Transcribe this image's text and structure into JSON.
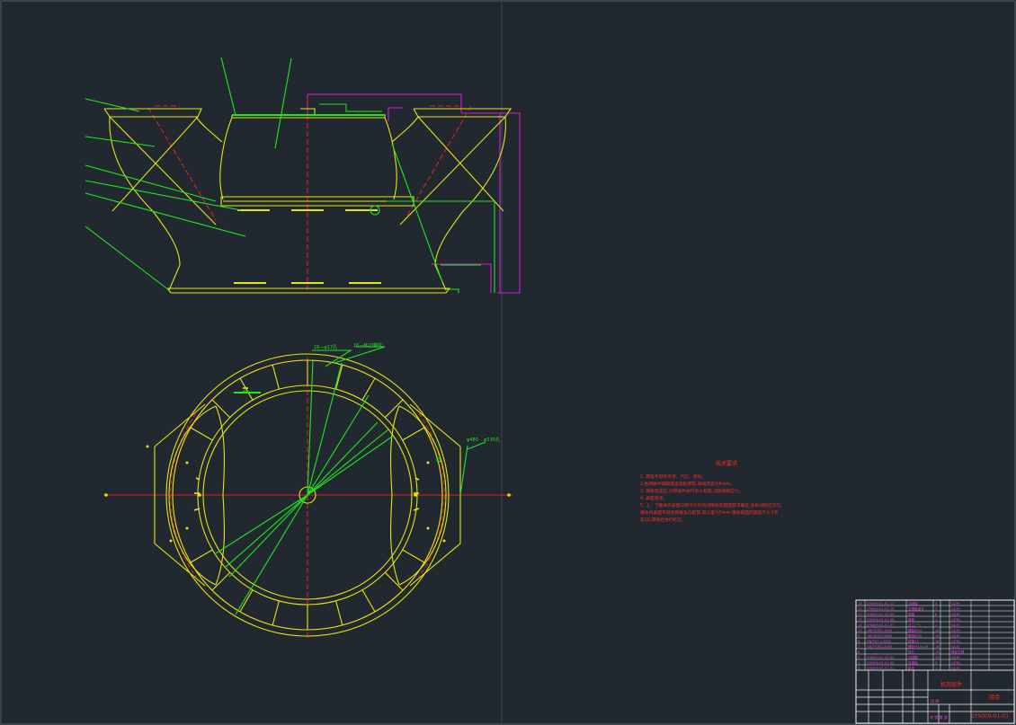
{
  "colors": {
    "background": "#212830",
    "outline": "#e4e414",
    "leader": "#1ee61e",
    "hidden": "#e11e1e",
    "boundary": "#d21ed2",
    "text_note": "#ff2a2a",
    "table_text": "#ff3ce6",
    "table_line": "#f2f2f2"
  },
  "labels": {
    "dim_top_1": "16—φ17孔",
    "dim_top_2": "16—M10螺纹",
    "dim_left": "80—",
    "dim_right_1": "φ480",
    "dim_right_2": "φ530孔"
  },
  "notes": {
    "title": "技术要求",
    "items": [
      "1. 焊缝不得有夹渣、气孔、裂纹。",
      "2.各焊接件焊脚高度按板厚取,焊缝高度为6mm。",
      "3. 焊接完成后,对焊接件进行退火处理,消除焊接应力。",
      "4. 表面涂漆。",
      "5. 上、下锥体内表面与转子叶片的间隙按装配图要求确定,各处间隙应均匀,",
      "   锥体内表面不得有焊瘤及凸起等,其公差为5mm,锥体表面的圆度不大于8",
      "   及10,焊接后进行校正。"
    ]
  },
  "title_block": {
    "drawing_name": "机壳组件",
    "material": "组合",
    "drawing_number": "LYS009-01-01",
    "scale_label": "比 例",
    "sheet_label": "共 张 第 张"
  },
  "parts": [
    {
      "no": "15",
      "code": "LYS009-01-01-11",
      "name": "加强板",
      "qty": "4",
      "mat": "Q235"
    },
    {
      "no": "14",
      "code": "LYS009-01-01-10",
      "name": "支撑板组件",
      "qty": "1",
      "mat": "Q235"
    },
    {
      "no": "13",
      "code": "LYS009-01-01-09",
      "name": "筋板",
      "qty": "8",
      "mat": "Q235"
    },
    {
      "no": "12",
      "code": "LYS009-01-01-08",
      "name": "锥体",
      "qty": "1",
      "mat": "Q235"
    },
    {
      "no": "11",
      "code": "LYS009-01-01-07",
      "name": "法兰(一)",
      "qty": "1",
      "mat": "Q235"
    },
    {
      "no": "10",
      "code": "GB/T5782-2000",
      "name": "螺栓M10",
      "qty": "16",
      "mat": "Q235"
    },
    {
      "no": "9",
      "code": "GB/T6170-2000",
      "name": "螺母M10",
      "qty": "16",
      "mat": "Q235"
    },
    {
      "no": "8",
      "code": "GB/T97.1-2002",
      "name": "垫圈10",
      "qty": "16",
      "mat": "Q235"
    },
    {
      "no": "7",
      "code": "GB/T5782-2000",
      "name": "螺栓M10×25",
      "qty": "16",
      "mat": "Q235"
    },
    {
      "no": "6",
      "code": "",
      "name": "垫片",
      "qty": "16",
      "mat": "橡胶石棉"
    },
    {
      "no": "5",
      "code": "LYS009-01-01-03",
      "name": "加强筋",
      "qty": "24",
      "mat": "Q235"
    },
    {
      "no": "4",
      "code": "LYS009-01-01-02",
      "name": "连接板",
      "qty": "2",
      "mat": "Q235"
    },
    {
      "no": "3",
      "code": "LYS009-01-01-01",
      "name": "机壳",
      "qty": "1",
      "mat": "Q235"
    }
  ]
}
